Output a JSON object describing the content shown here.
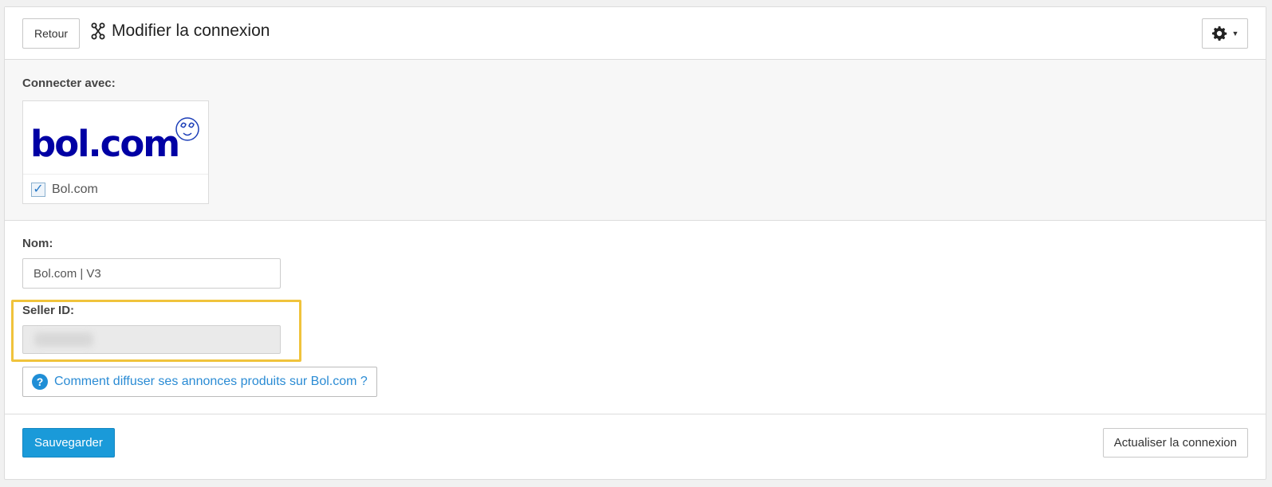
{
  "header": {
    "back_label": "Retour",
    "title": "Modifier la connexion",
    "title_icon": "connection-nodes-icon",
    "settings_icon": "gear-icon"
  },
  "connect": {
    "label": "Connecter avec:",
    "card": {
      "logo_text": "bol.com",
      "name": "Bol.com",
      "checked": true
    }
  },
  "form": {
    "nom_label": "Nom:",
    "nom_value": "Bol.com | V3",
    "seller_label": "Seller ID:",
    "seller_value": "",
    "help_label": "Comment diffuser ses annonces produits sur Bol.com ?",
    "help_icon": "question-circle-icon"
  },
  "footer": {
    "save_label": "Sauvegarder",
    "refresh_label": "Actualiser la connexion"
  },
  "colors": {
    "primary": "#1a9ad9",
    "link": "#2a8bd4",
    "highlight": "#f0c33c",
    "bol_blue": "#0000a4"
  }
}
